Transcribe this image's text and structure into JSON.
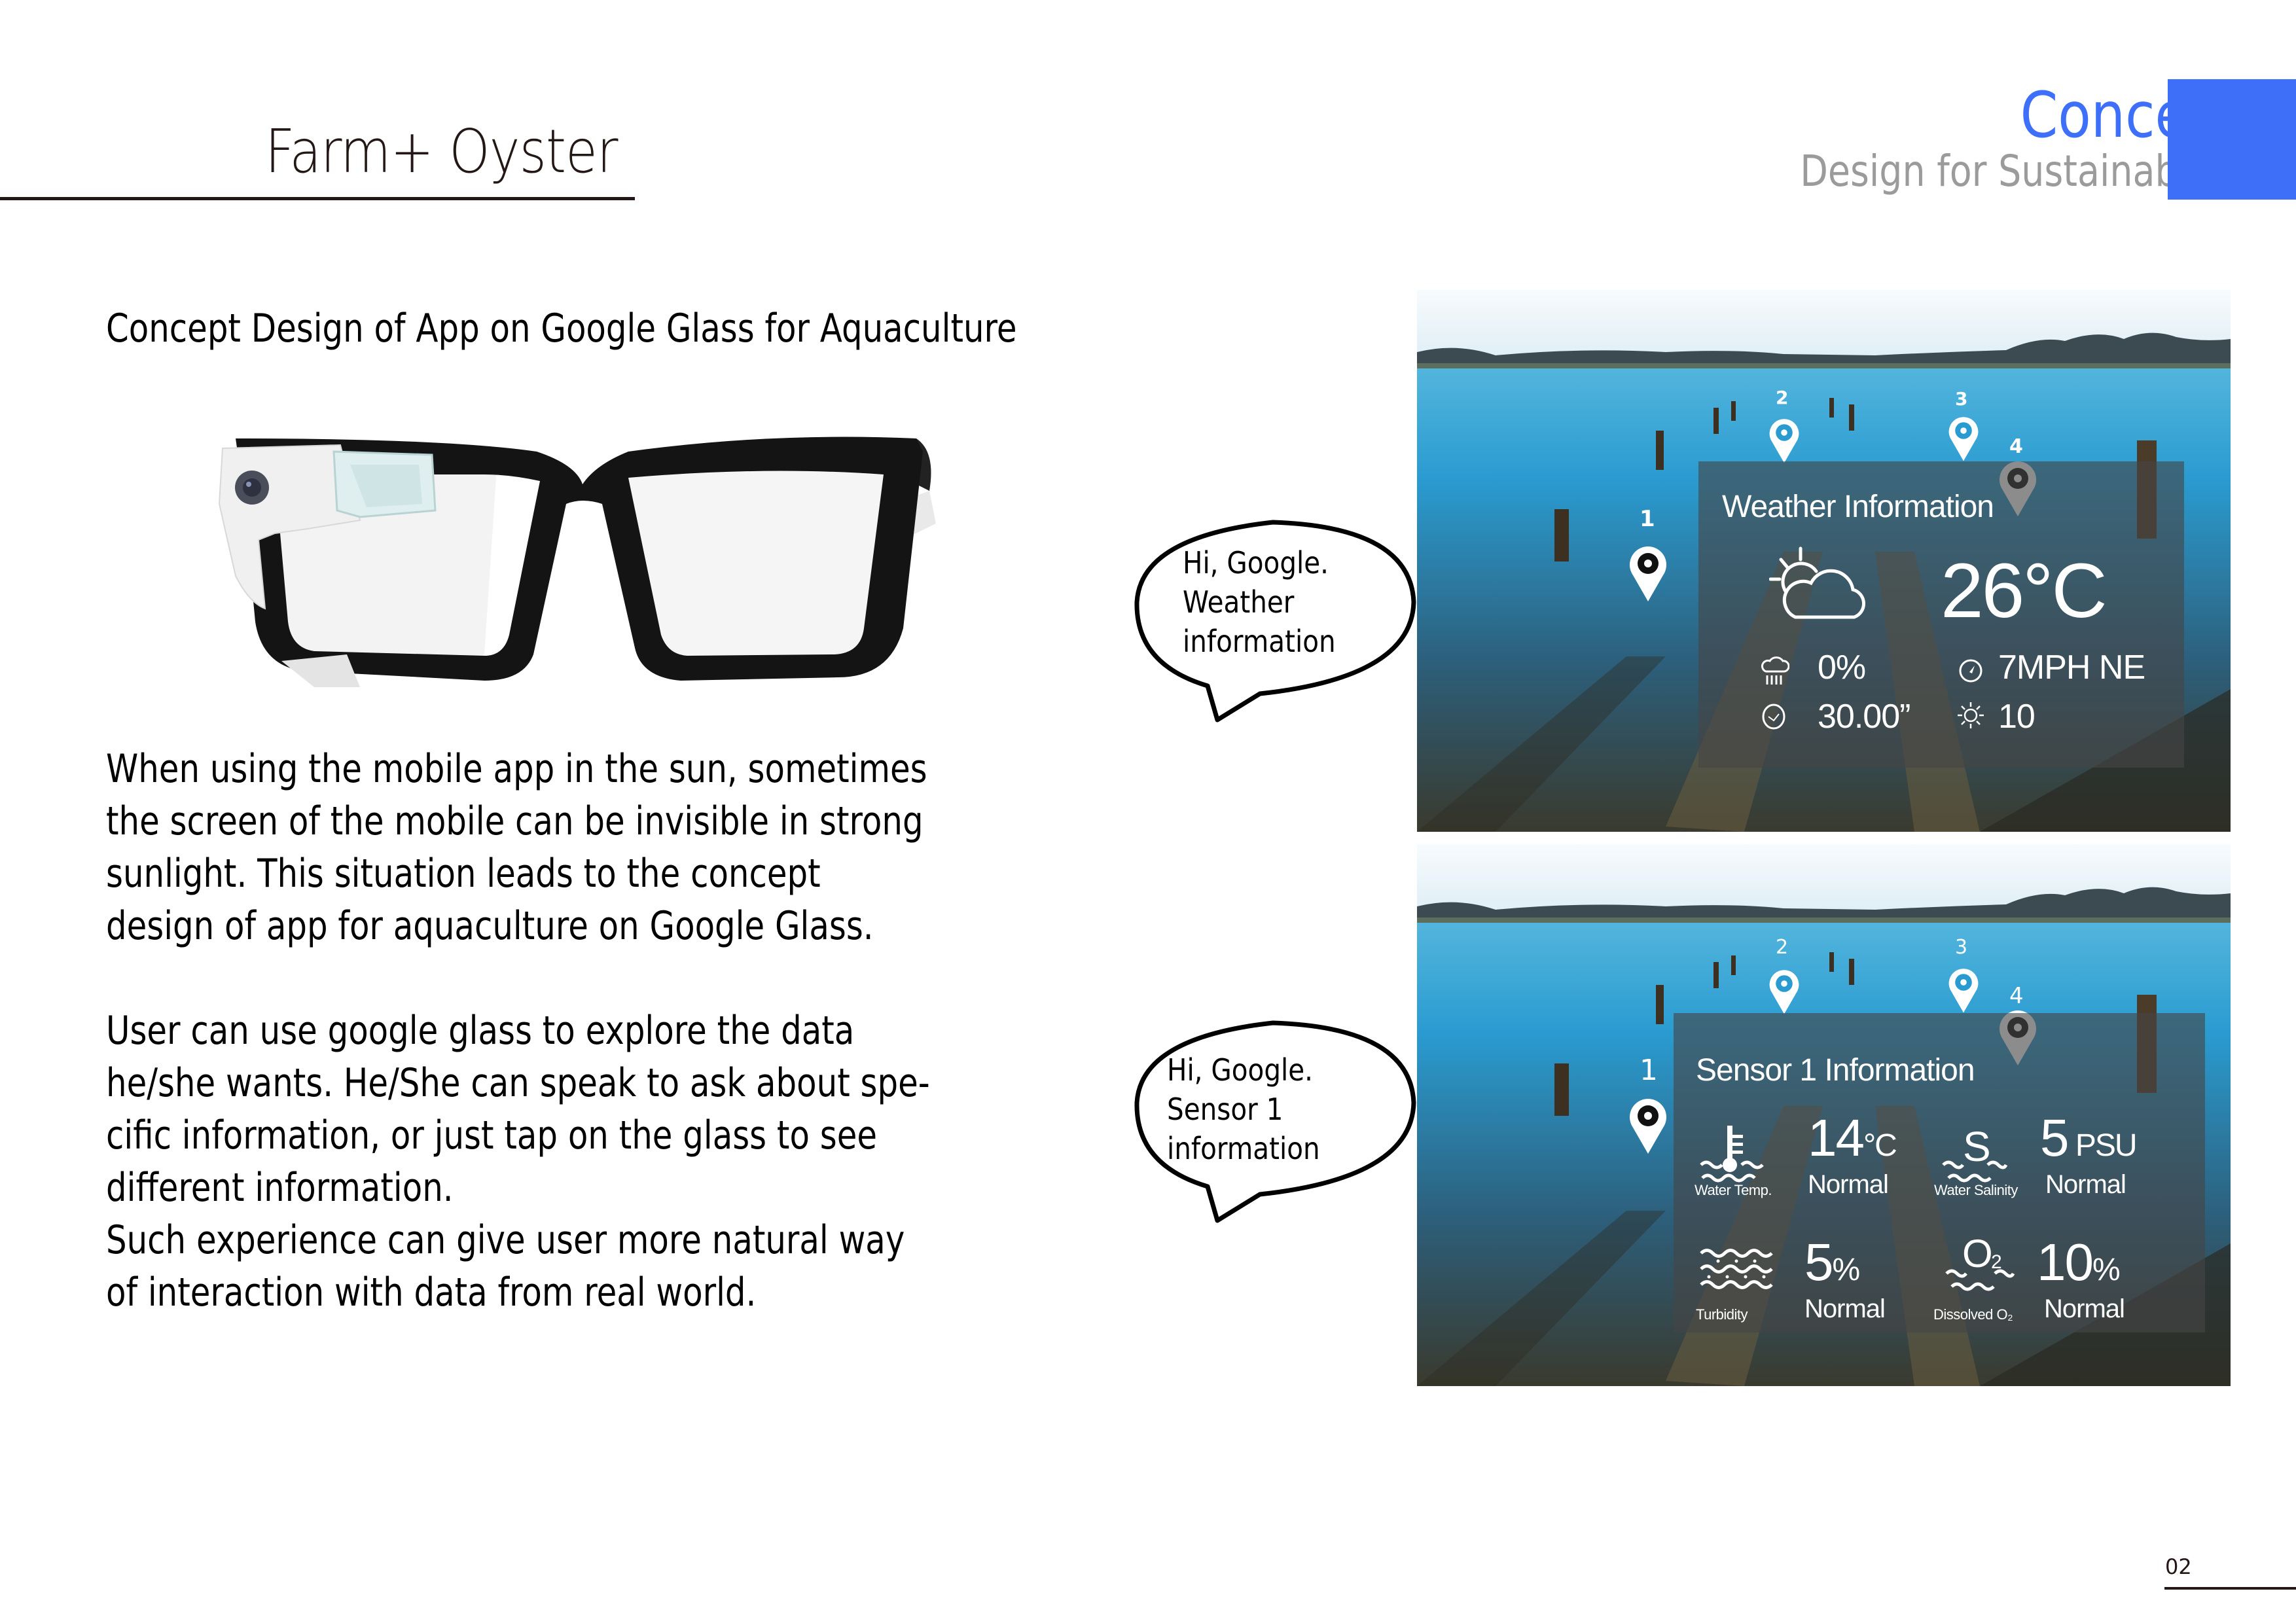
{
  "header": {
    "title": "Farm+ Oyster",
    "section": "Concept",
    "section_subtitle": "Design for Sustainability",
    "accent_color": "#3d6ff9"
  },
  "content": {
    "subtitle": "Concept Design of App on Google Glass for Aquaculture",
    "paragraph1": "When using the mobile app in the sun, sometimes\nthe screen of the mobile can be invisible in strong\nsunlight. This situation leads to the concept\ndesign of app for aquaculture on Google Glass.",
    "paragraph2": "User can use google glass to explore the data\nhe/she wants. He/She can speak to ask about spe-\ncific information, or just tap on the glass to see\ndifferent information.\nSuch experience can give user more natural way\nof interaction with data from real world.",
    "product_image": "google-glass-frames"
  },
  "bubbles": [
    {
      "text": "Hi, Google.\nWeather\ninformation"
    },
    {
      "text": "Hi, Google.\nSensor 1\ninformation"
    }
  ],
  "pins": [
    "1",
    "2",
    "3",
    "4"
  ],
  "weather": {
    "title": "Weather Information",
    "condition_icon": "partly-cloudy-icon",
    "temperature": "26°C",
    "precipitation": "0%",
    "wind": "7MPH NE",
    "pressure": "30.00”",
    "uv_index": "10"
  },
  "sensor": {
    "title": "Sensor 1 Information",
    "metrics": [
      {
        "label": "Water Temp.",
        "value": "14",
        "unit": "°C",
        "status": "Normal",
        "icon": "water-temperature-icon"
      },
      {
        "label": "Water Salinity",
        "value": "5",
        "unit": " PSU",
        "status": "Normal",
        "icon": "salinity-icon"
      },
      {
        "label": "Turbidity",
        "value": "5",
        "unit": "%",
        "status": "Normal",
        "icon": "turbidity-icon"
      },
      {
        "label": "Dissolved O₂",
        "value": "10",
        "unit": "%",
        "status": "Normal",
        "icon": "dissolved-oxygen-icon"
      }
    ]
  },
  "footer": {
    "page_number": "02"
  }
}
